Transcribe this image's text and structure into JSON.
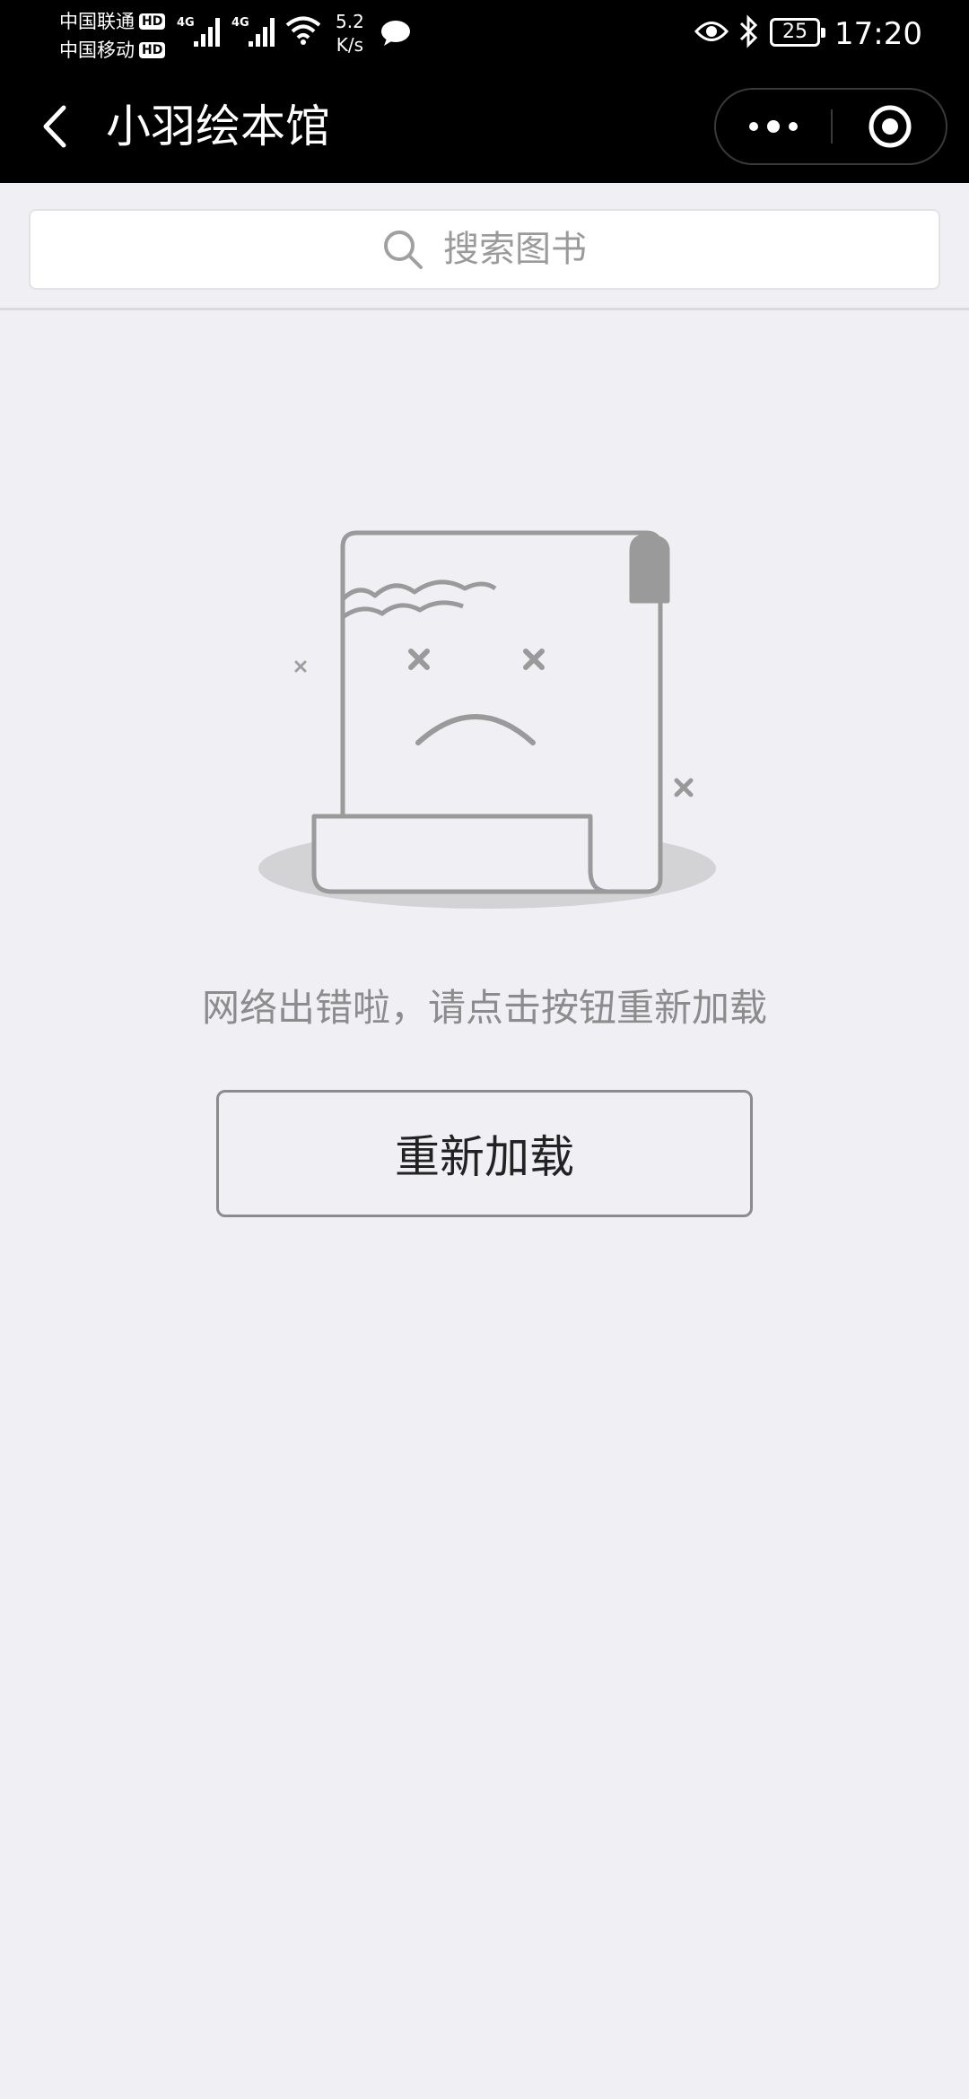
{
  "status_bar": {
    "carrier_1": "中国联通",
    "carrier_2": "中国移动",
    "hd_badge": "HD",
    "network_1": "4G",
    "network_2": "4G",
    "speed_value": "5.2",
    "speed_unit": "K/s",
    "battery_level": "25",
    "time": "17:20",
    "icons": [
      "signal-icon",
      "wifi-icon",
      "chat-icon",
      "eye-icon",
      "bluetooth-icon",
      "battery-icon"
    ]
  },
  "nav": {
    "title": "小羽绘本馆",
    "icons": [
      "back-arrow-icon",
      "more-dots-icon",
      "target-close-icon"
    ]
  },
  "search": {
    "placeholder": "搜索图书",
    "icon": "search-icon"
  },
  "error": {
    "illustration": "sad-scroll-illustration",
    "message": "网络出错啦，请点击按钮重新加载",
    "reload_label": "重新加载"
  },
  "colors": {
    "header_bg": "#000000",
    "page_bg": "#efeff4",
    "muted_text": "#8c8c8c",
    "illustration_gray": "#9a9a9a"
  }
}
